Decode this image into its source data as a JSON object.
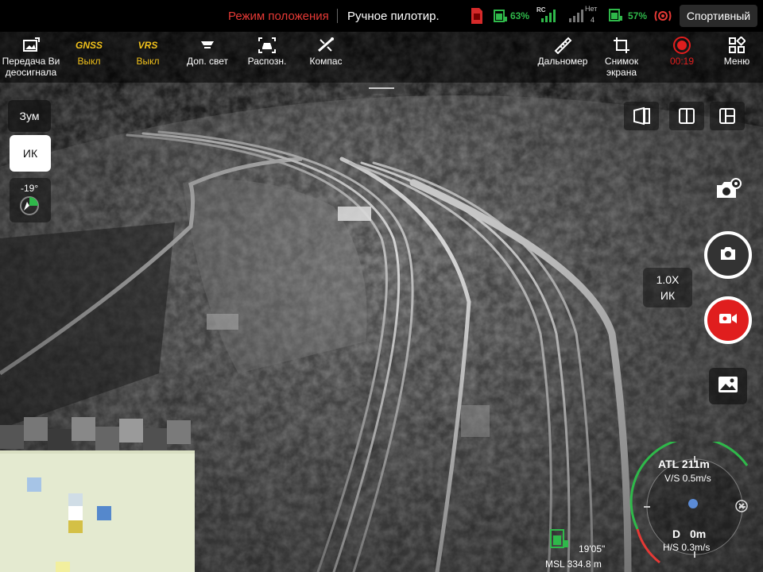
{
  "status": {
    "mode_warning": "Режим положения",
    "flight_mode": "Ручное пилотир.",
    "battery_drone": "63%",
    "rc_label": "RC",
    "net_label": "Нет",
    "net_value": "4",
    "battery_rc": "57%",
    "sport_mode": "Спортивный"
  },
  "toolbar": {
    "video_transfer": "Передача Ви деосигнала",
    "gnss_icon": "GNSS",
    "gnss_state": "Выкл",
    "vrs_icon": "VRS",
    "vrs_state": "Выкл",
    "aux_light": "Доп. свет",
    "recognition": "Распозн.",
    "compass": "Компас",
    "rangefinder": "Дальномер",
    "screenshot": "Снимок экрана",
    "rec_time": "00:19",
    "menu": "Меню"
  },
  "left_panel": {
    "zoom": "Зум",
    "ir": "ИК",
    "temperature": "-19°"
  },
  "right_panel": {
    "zoom_level": "1.0X",
    "zoom_mode": "ИК"
  },
  "telemetry": {
    "atl_label": "ATL",
    "atl_value": "211m",
    "vs": "V/S 0.5m/s",
    "d_label": "D",
    "d_value": "0m",
    "hs": "H/S 0.3m/s",
    "msl": "MSL 334.8 m",
    "home_time": "19'05\""
  },
  "colors": {
    "accent_red": "#e53935",
    "battery_green": "#2fb84a",
    "gnss_yellow": "#f2c21b",
    "record_red": "#e01e1e"
  }
}
